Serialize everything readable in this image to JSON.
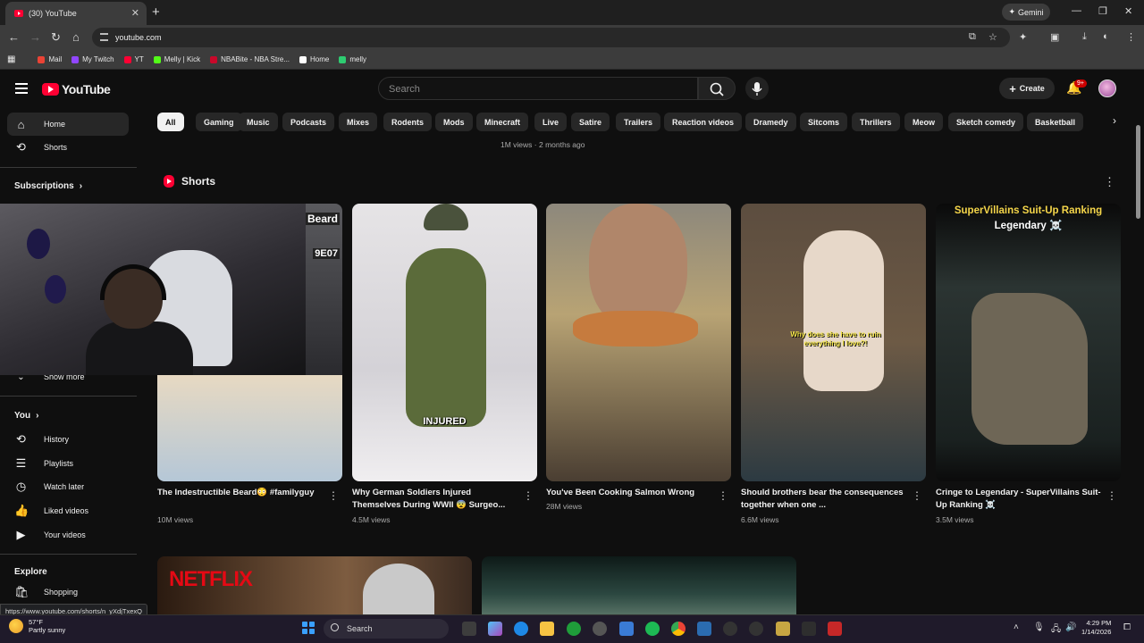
{
  "browser": {
    "tab_title": "(30) YouTube",
    "tab_close": "✕",
    "new_tab": "+",
    "gemini_label": "Gemini",
    "url": "youtube.com",
    "status_url": "https://www.youtube.com/shorts/n_yXdjTxexQ",
    "bookmarks": [
      {
        "label": "Mail",
        "color": "#ea4335"
      },
      {
        "label": "My Twitch",
        "color": "#9146ff"
      },
      {
        "label": "YT",
        "color": "#ff0033"
      },
      {
        "label": "Melly | Kick",
        "color": "#53fc18"
      },
      {
        "label": "NBABite - NBA Stre...",
        "color": "#c9082a"
      },
      {
        "label": "Home",
        "color": "#ffffff"
      },
      {
        "label": "melly",
        "color": "#2ecc71"
      }
    ]
  },
  "header": {
    "logo_text": "YouTube",
    "search_placeholder": "Search",
    "create_label": "Create",
    "notifications_badge": "9+"
  },
  "sidebar": {
    "home": "Home",
    "shorts": "Shorts",
    "subscriptions": "Subscriptions",
    "show_more": "Show more",
    "you": "You",
    "history": "History",
    "playlists": "Playlists",
    "watch_later": "Watch later",
    "liked_videos": "Liked videos",
    "your_videos": "Your videos",
    "explore": "Explore",
    "shopping": "Shopping"
  },
  "chips": [
    "All",
    "Gaming",
    "Music",
    "Podcasts",
    "Mixes",
    "Rodents",
    "Mods",
    "Minecraft",
    "Live",
    "Satire",
    "Trailers",
    "Reaction videos",
    "Dramedy",
    "Sitcoms",
    "Thrillers",
    "Meow",
    "Sketch comedy",
    "Basketball"
  ],
  "top_meta": "1M views · 2 months ago",
  "shorts": {
    "section_title": "Shorts",
    "items": [
      {
        "title": "The Indestructible Beard😳 #familyguy",
        "views": "10M views",
        "overlay": "Beard",
        "overlay2": "9E07"
      },
      {
        "title": "Why German Soldiers Injured Themselves During WWII 😨 Surgeo...",
        "views": "4.5M views",
        "overlay": "INJURED"
      },
      {
        "title": "You've Been Cooking Salmon Wrong",
        "views": "28M views"
      },
      {
        "title": "Should brothers bear the consequences together when one ...",
        "views": "6.6M views",
        "overlay": "Why does she have to ruin everything I love?!"
      },
      {
        "title": "Cringe to Legendary - SuperVillains Suit-Up Ranking ☠️",
        "views": "3.5M views",
        "overlay": "SuperVillains Suit-Up Ranking",
        "overlay2": "Legendary ☠️"
      }
    ]
  },
  "lower_row": {
    "thumb1_text": "NETFLIX"
  },
  "taskbar": {
    "temperature": "57°F",
    "weather": "Partly sunny",
    "search_label": "Search",
    "time": "4:29 PM",
    "date": "1/14/2026"
  }
}
